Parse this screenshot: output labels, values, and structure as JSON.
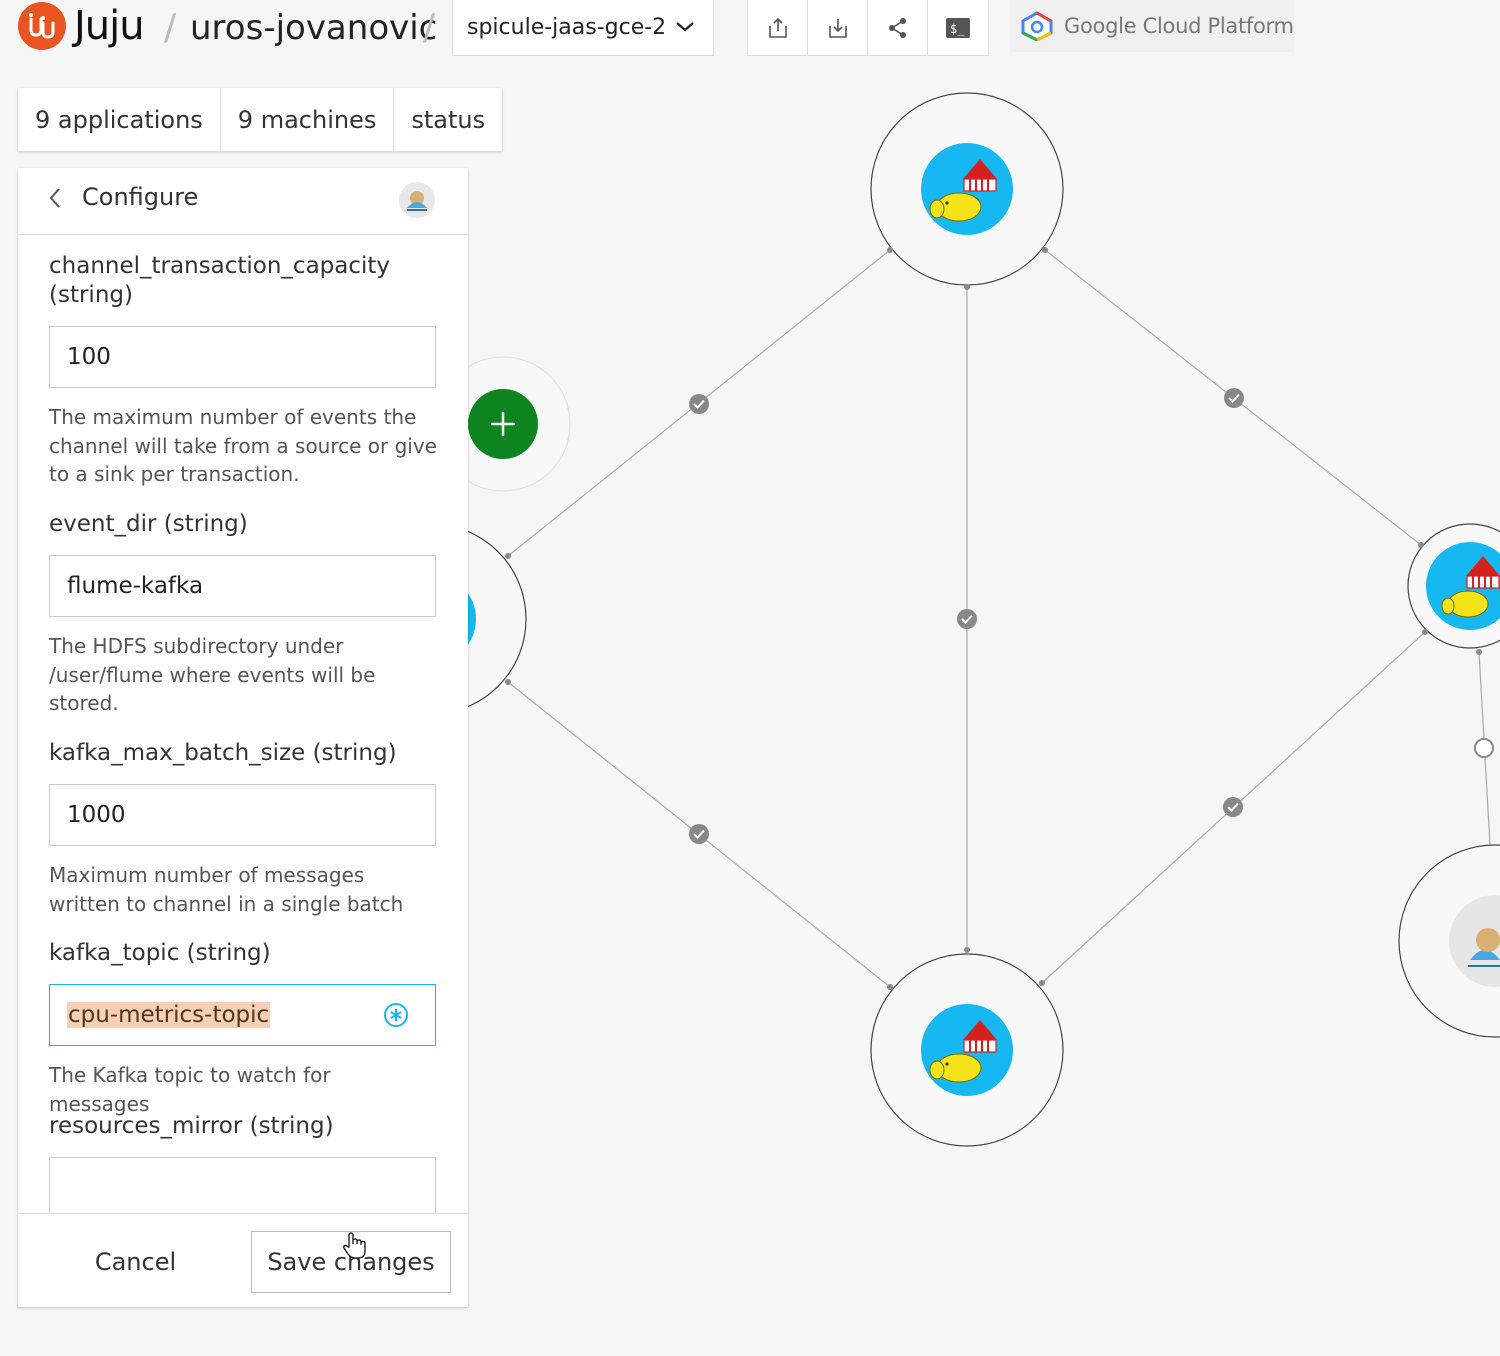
{
  "header": {
    "brand": "Juju",
    "user": "uros-jovanovic",
    "model": "spicule-jaas-gce-2",
    "cloud": "Google Cloud Platform",
    "toolbar_icons": [
      "export-icon",
      "import-icon",
      "share-icon",
      "terminal-icon"
    ]
  },
  "counts": {
    "applications": "9 applications",
    "machines": "9 machines",
    "status": "status"
  },
  "panel": {
    "title": "Configure",
    "fields": [
      {
        "label": "channel_transaction_capacity (string)",
        "value": "100",
        "description": "The maximum number of events the channel will take from a source or give to a sink per transaction."
      },
      {
        "label": "event_dir (string)",
        "value": "flume-kafka",
        "description": "The HDFS subdirectory under /user/flume where events will be stored."
      },
      {
        "label": "kafka_max_batch_size (string)",
        "value": "1000",
        "description": "Maximum number of messages written to channel in a single batch"
      },
      {
        "label": "kafka_topic (string)",
        "value": "cpu-metrics-topic",
        "description": "The Kafka topic to watch for messages"
      },
      {
        "label": "resources_mirror (string)",
        "value": ""
      }
    ],
    "cancel": "Cancel",
    "save": "Save changes"
  },
  "colors": {
    "accent": "#e95420",
    "add_button": "#0e8420",
    "app_icon_bg": "#15b8f0",
    "active_border": "#19b6ee",
    "highlight": "#f8cfb5"
  }
}
